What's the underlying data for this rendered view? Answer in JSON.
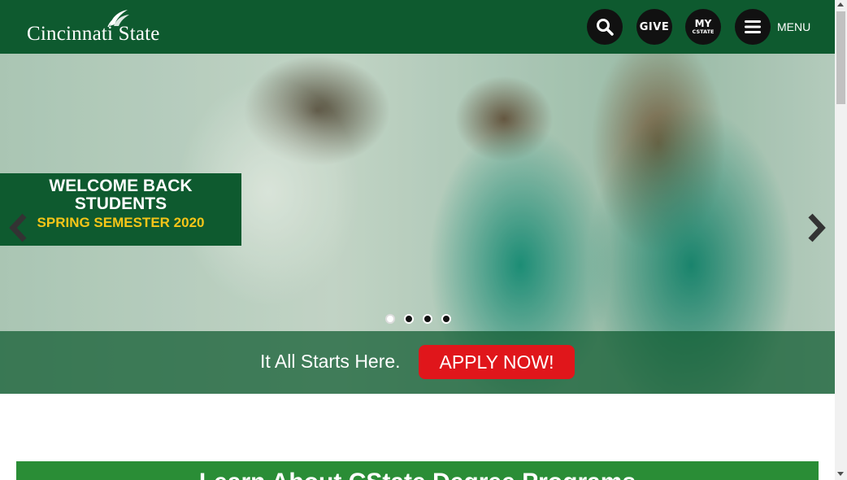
{
  "header": {
    "logo_text": "Cincinnati State",
    "menu_label": "MENU",
    "give_label": "GIVE",
    "mycstate_top": "MY",
    "mycstate_bottom": "CSTATE"
  },
  "icons": {
    "search": "search-icon",
    "menu": "hamburger-icon",
    "prev": "chevron-left-icon",
    "next": "chevron-right-icon"
  },
  "hero": {
    "welcome_line1": "WELCOME BACK",
    "welcome_line2": "STUDENTS",
    "welcome_line3": "SPRING SEMESTER 2020",
    "slide_count": 4,
    "active_slide": 1,
    "tagline": "It All Starts Here.",
    "apply_label": "APPLY NOW!"
  },
  "section": {
    "banner_title": "Learn About CState Degree Programs"
  },
  "colors": {
    "brand_green": "#0e5a2f",
    "apply_red": "#e0161b",
    "accent_yellow": "#f5c518",
    "banner_green": "#2a8d36"
  }
}
